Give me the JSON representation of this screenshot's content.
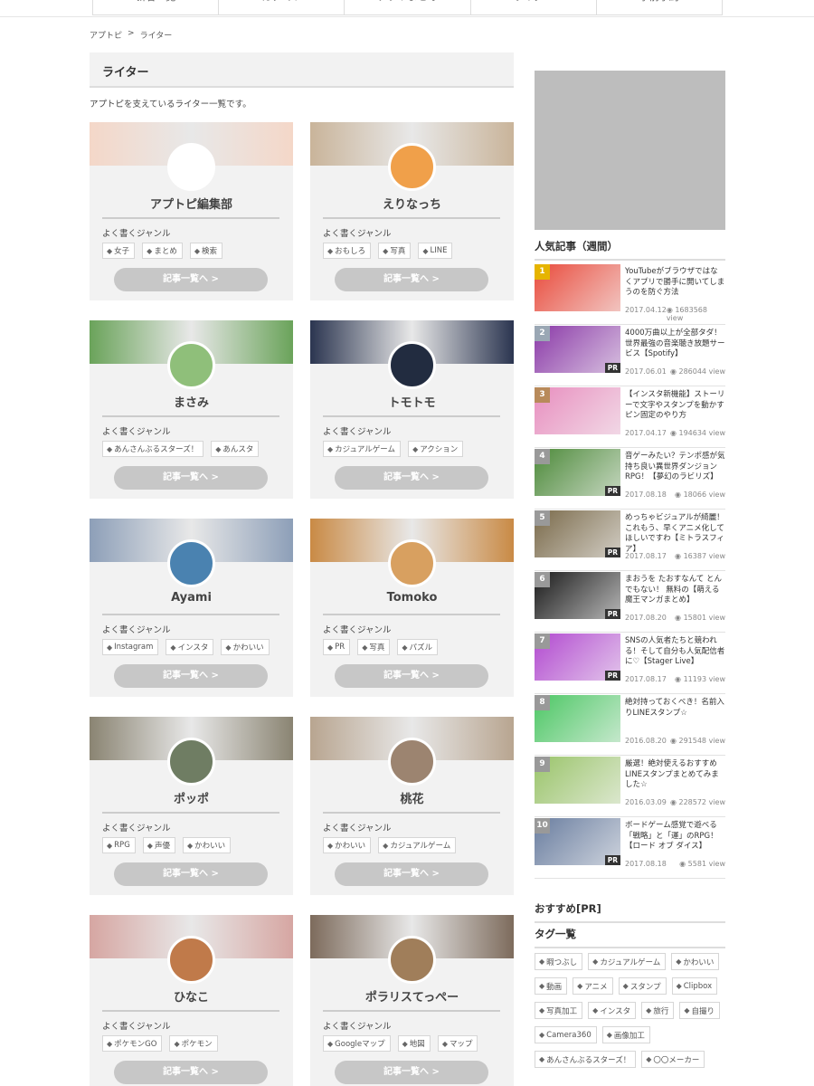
{
  "topnav": [
    "新着一覧",
    "カテゴリ",
    "アプリまとめ",
    "ライター",
    "事前予約"
  ],
  "breadcrumb": [
    "アプトピ",
    ">",
    "ライター"
  ],
  "page_title": "ライター",
  "page_desc": "アプトピを支えているライター一覧です。",
  "genre_label": "よく書くジャンル",
  "button_label": "記事一覧へ >",
  "writers": [
    {
      "name": "アプトピ編集部",
      "tags": [
        "女子",
        "まとめ",
        "検索"
      ],
      "cover": "#f4d7c8",
      "avatar": "#ffffff"
    },
    {
      "name": "えりなっち",
      "tags": [
        "おもしろ",
        "写真",
        "LINE"
      ],
      "cover": "#c9b49a",
      "avatar": "#f0a04a"
    },
    {
      "name": "まさみ",
      "tags": [
        "あんさんぶるスターズ！",
        "あんスタ"
      ],
      "cover": "#6aa35a",
      "avatar": "#8fbf7a"
    },
    {
      "name": "トモトモ",
      "tags": [
        "カジュアルゲーム",
        "アクション"
      ],
      "cover": "#2b3550",
      "avatar": "#222c40"
    },
    {
      "name": "Ayami",
      "tags": [
        "Instagram",
        "インスタ",
        "かわいい"
      ],
      "cover": "#8d9fb8",
      "avatar": "#4a82b0"
    },
    {
      "name": "Tomoko",
      "tags": [
        "PR",
        "写真",
        "パズル"
      ],
      "cover": "#c98a45",
      "avatar": "#d8a060"
    },
    {
      "name": "ポッポ",
      "tags": [
        "RPG",
        "声優",
        "かわいい"
      ],
      "cover": "#8a8472",
      "avatar": "#6f7d63"
    },
    {
      "name": "桃花",
      "tags": [
        "かわいい",
        "カジュアルゲーム"
      ],
      "cover": "#b8a590",
      "avatar": "#9c8470"
    },
    {
      "name": "ひなこ",
      "tags": [
        "ポケモンGO",
        "ポケモン"
      ],
      "cover": "#d6a6a2",
      "avatar": "#c07a4a"
    },
    {
      "name": "ポラリスてっぺー",
      "tags": [
        "Googleマップ",
        "地図",
        "マップ"
      ],
      "cover": "#7d6b5c",
      "avatar": "#a07e5a"
    }
  ],
  "popular_heading": "人気記事（週間）",
  "popular": [
    {
      "rank": "1",
      "title": "YouTubeがブラウザではなくアプリで勝手に開いてしまうのを防ぐ方法",
      "date": "2017.04.12",
      "views": "1683568 view",
      "pr": false,
      "thumb": "#e94b3c",
      "rank_color": "#e6b400"
    },
    {
      "rank": "2",
      "title": "4000万曲以上が全部タダ！世界最強の音楽聴き放題サービス【Spotify】",
      "date": "2017.06.01",
      "views": "286044 view",
      "pr": true,
      "thumb": "#8b3aa8",
      "rank_color": "#9aa7b4"
    },
    {
      "rank": "3",
      "title": "【インスタ新機能】ストーリーで文字やスタンプを動かすピン固定のやり方",
      "date": "2017.04.17",
      "views": "194634 view",
      "pr": false,
      "thumb": "#e88fbf",
      "rank_color": "#b88a5a"
    },
    {
      "rank": "4",
      "title": "音ゲーみたい？テンポ感が気持ち良い異世界ダンジョンRPG！【夢幻のラビリズ】",
      "date": "2017.08.18",
      "views": "18066 view",
      "pr": true,
      "thumb": "#4d8a3a",
      "rank_color": "#999999"
    },
    {
      "rank": "5",
      "title": "めっちゃビジュアルが綺麗！これもう、早くアニメ化してほしいですわ【ミトラスフィア】",
      "date": "2017.08.17",
      "views": "16387 view",
      "pr": true,
      "thumb": "#7a6a4a",
      "rank_color": "#999999"
    },
    {
      "rank": "6",
      "title": "まおうを たおすなんて とんでもない！ 無料の【萌える魔王マンガまとめ】",
      "date": "2017.08.20",
      "views": "15801 view",
      "pr": true,
      "thumb": "#1a1a1a",
      "rank_color": "#999999"
    },
    {
      "rank": "7",
      "title": "SNSの人気者たちと競われる！そして自分も人気配信者に♡【Stager Live】",
      "date": "2017.08.17",
      "views": "11193 view",
      "pr": true,
      "thumb": "#b24ad0",
      "rank_color": "#999999"
    },
    {
      "rank": "8",
      "title": "絶対持っておくべき！名前入りLINEスタンプ☆",
      "date": "2016.08.20",
      "views": "291548 view",
      "pr": false,
      "thumb": "#4cc764",
      "rank_color": "#999999"
    },
    {
      "rank": "9",
      "title": "厳選！絶対使えるおすすめLINEスタンプまとめてみました☆",
      "date": "2016.03.09",
      "views": "228572 view",
      "pr": false,
      "thumb": "#9ac46a",
      "rank_color": "#999999"
    },
    {
      "rank": "10",
      "title": "ボードゲーム感覚で遊べる「戦略」と「運」のRPG！【ロード オブ ダイス】",
      "date": "2017.08.18",
      "views": "5581 view",
      "pr": true,
      "thumb": "#6a7ea0",
      "rank_color": "#999999"
    }
  ],
  "recommend_heading": "おすすめ[PR]",
  "tags_heading": "タグ一覧",
  "tag_cloud": [
    "暇つぶし",
    "カジュアルゲーム",
    "かわいい",
    "動画",
    "アニメ",
    "スタンプ",
    "Clipbox",
    "写真加工",
    "インスタ",
    "旅行",
    "自撮り",
    "Camera360",
    "画像加工",
    "あんさんぶるスターズ！",
    "〇〇メーカー"
  ],
  "icons": {
    "tag": "tag-icon",
    "eye": "eye-icon"
  }
}
